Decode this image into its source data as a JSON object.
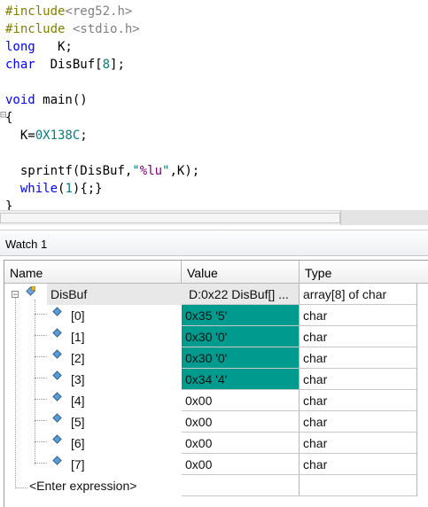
{
  "editor": {
    "lines": [
      {
        "id": "l1",
        "segments": [
          {
            "cls": "pp",
            "text": "#include"
          },
          {
            "cls": "inc",
            "text": "<reg52.h>"
          }
        ]
      },
      {
        "id": "l2",
        "segments": [
          {
            "cls": "pp",
            "text": "#include "
          },
          {
            "cls": "inc",
            "text": "<stdio.h>"
          }
        ]
      },
      {
        "id": "l3",
        "segments": [
          {
            "cls": "kw",
            "text": "long"
          },
          {
            "cls": "",
            "text": "   K;"
          }
        ]
      },
      {
        "id": "l4",
        "segments": [
          {
            "cls": "kw",
            "text": "char"
          },
          {
            "cls": "",
            "text": "  DisBuf["
          },
          {
            "cls": "num",
            "text": "8"
          },
          {
            "cls": "",
            "text": "];"
          }
        ]
      },
      {
        "id": "l5",
        "segments": [
          {
            "cls": "",
            "text": ""
          }
        ]
      },
      {
        "id": "l6",
        "segments": [
          {
            "cls": "kw",
            "text": "void"
          },
          {
            "cls": "",
            "text": " main()"
          }
        ]
      },
      {
        "id": "l7",
        "segments": [
          {
            "cls": "",
            "text": "{"
          }
        ]
      },
      {
        "id": "l8",
        "segments": [
          {
            "cls": "",
            "text": "  K="
          },
          {
            "cls": "num",
            "text": "0X138C"
          },
          {
            "cls": "",
            "text": ";"
          }
        ]
      },
      {
        "id": "l9",
        "segments": [
          {
            "cls": "",
            "text": ""
          }
        ]
      },
      {
        "id": "l10",
        "segments": [
          {
            "cls": "",
            "text": "  sprintf(DisBuf,"
          },
          {
            "cls": "str",
            "text": "\""
          },
          {
            "cls": "fmt",
            "text": "%lu"
          },
          {
            "cls": "str",
            "text": "\""
          },
          {
            "cls": "",
            "text": ",K);"
          }
        ]
      },
      {
        "id": "l11",
        "segments": [
          {
            "cls": "",
            "text": "  "
          },
          {
            "cls": "kw",
            "text": "while"
          },
          {
            "cls": "",
            "text": "("
          },
          {
            "cls": "num",
            "text": "1"
          },
          {
            "cls": "",
            "text": "){;}"
          }
        ]
      },
      {
        "id": "l12",
        "segments": [
          {
            "cls": "",
            "text": "}"
          }
        ]
      }
    ]
  },
  "watch": {
    "title": "Watch 1",
    "columns": {
      "name": "Name",
      "value": "Value",
      "type": "Type"
    },
    "root": {
      "name": "DisBuf",
      "value": "D:0x22 DisBuf[] ...",
      "type": "array[8] of char"
    },
    "rows": [
      {
        "name": "[0]",
        "value": "0x35 '5'",
        "type": "char",
        "changed": true
      },
      {
        "name": "[1]",
        "value": "0x30 '0'",
        "type": "char",
        "changed": true
      },
      {
        "name": "[2]",
        "value": "0x30 '0'",
        "type": "char",
        "changed": true
      },
      {
        "name": "[3]",
        "value": "0x34 '4'",
        "type": "char",
        "changed": true
      },
      {
        "name": "[4]",
        "value": "0x00",
        "type": "char",
        "changed": false
      },
      {
        "name": "[5]",
        "value": "0x00",
        "type": "char",
        "changed": false
      },
      {
        "name": "[6]",
        "value": "0x00",
        "type": "char",
        "changed": false
      },
      {
        "name": "[7]",
        "value": "0x00",
        "type": "char",
        "changed": false
      }
    ],
    "enter_expression": "<Enter expression>",
    "highlight_color": "#009b8f"
  }
}
